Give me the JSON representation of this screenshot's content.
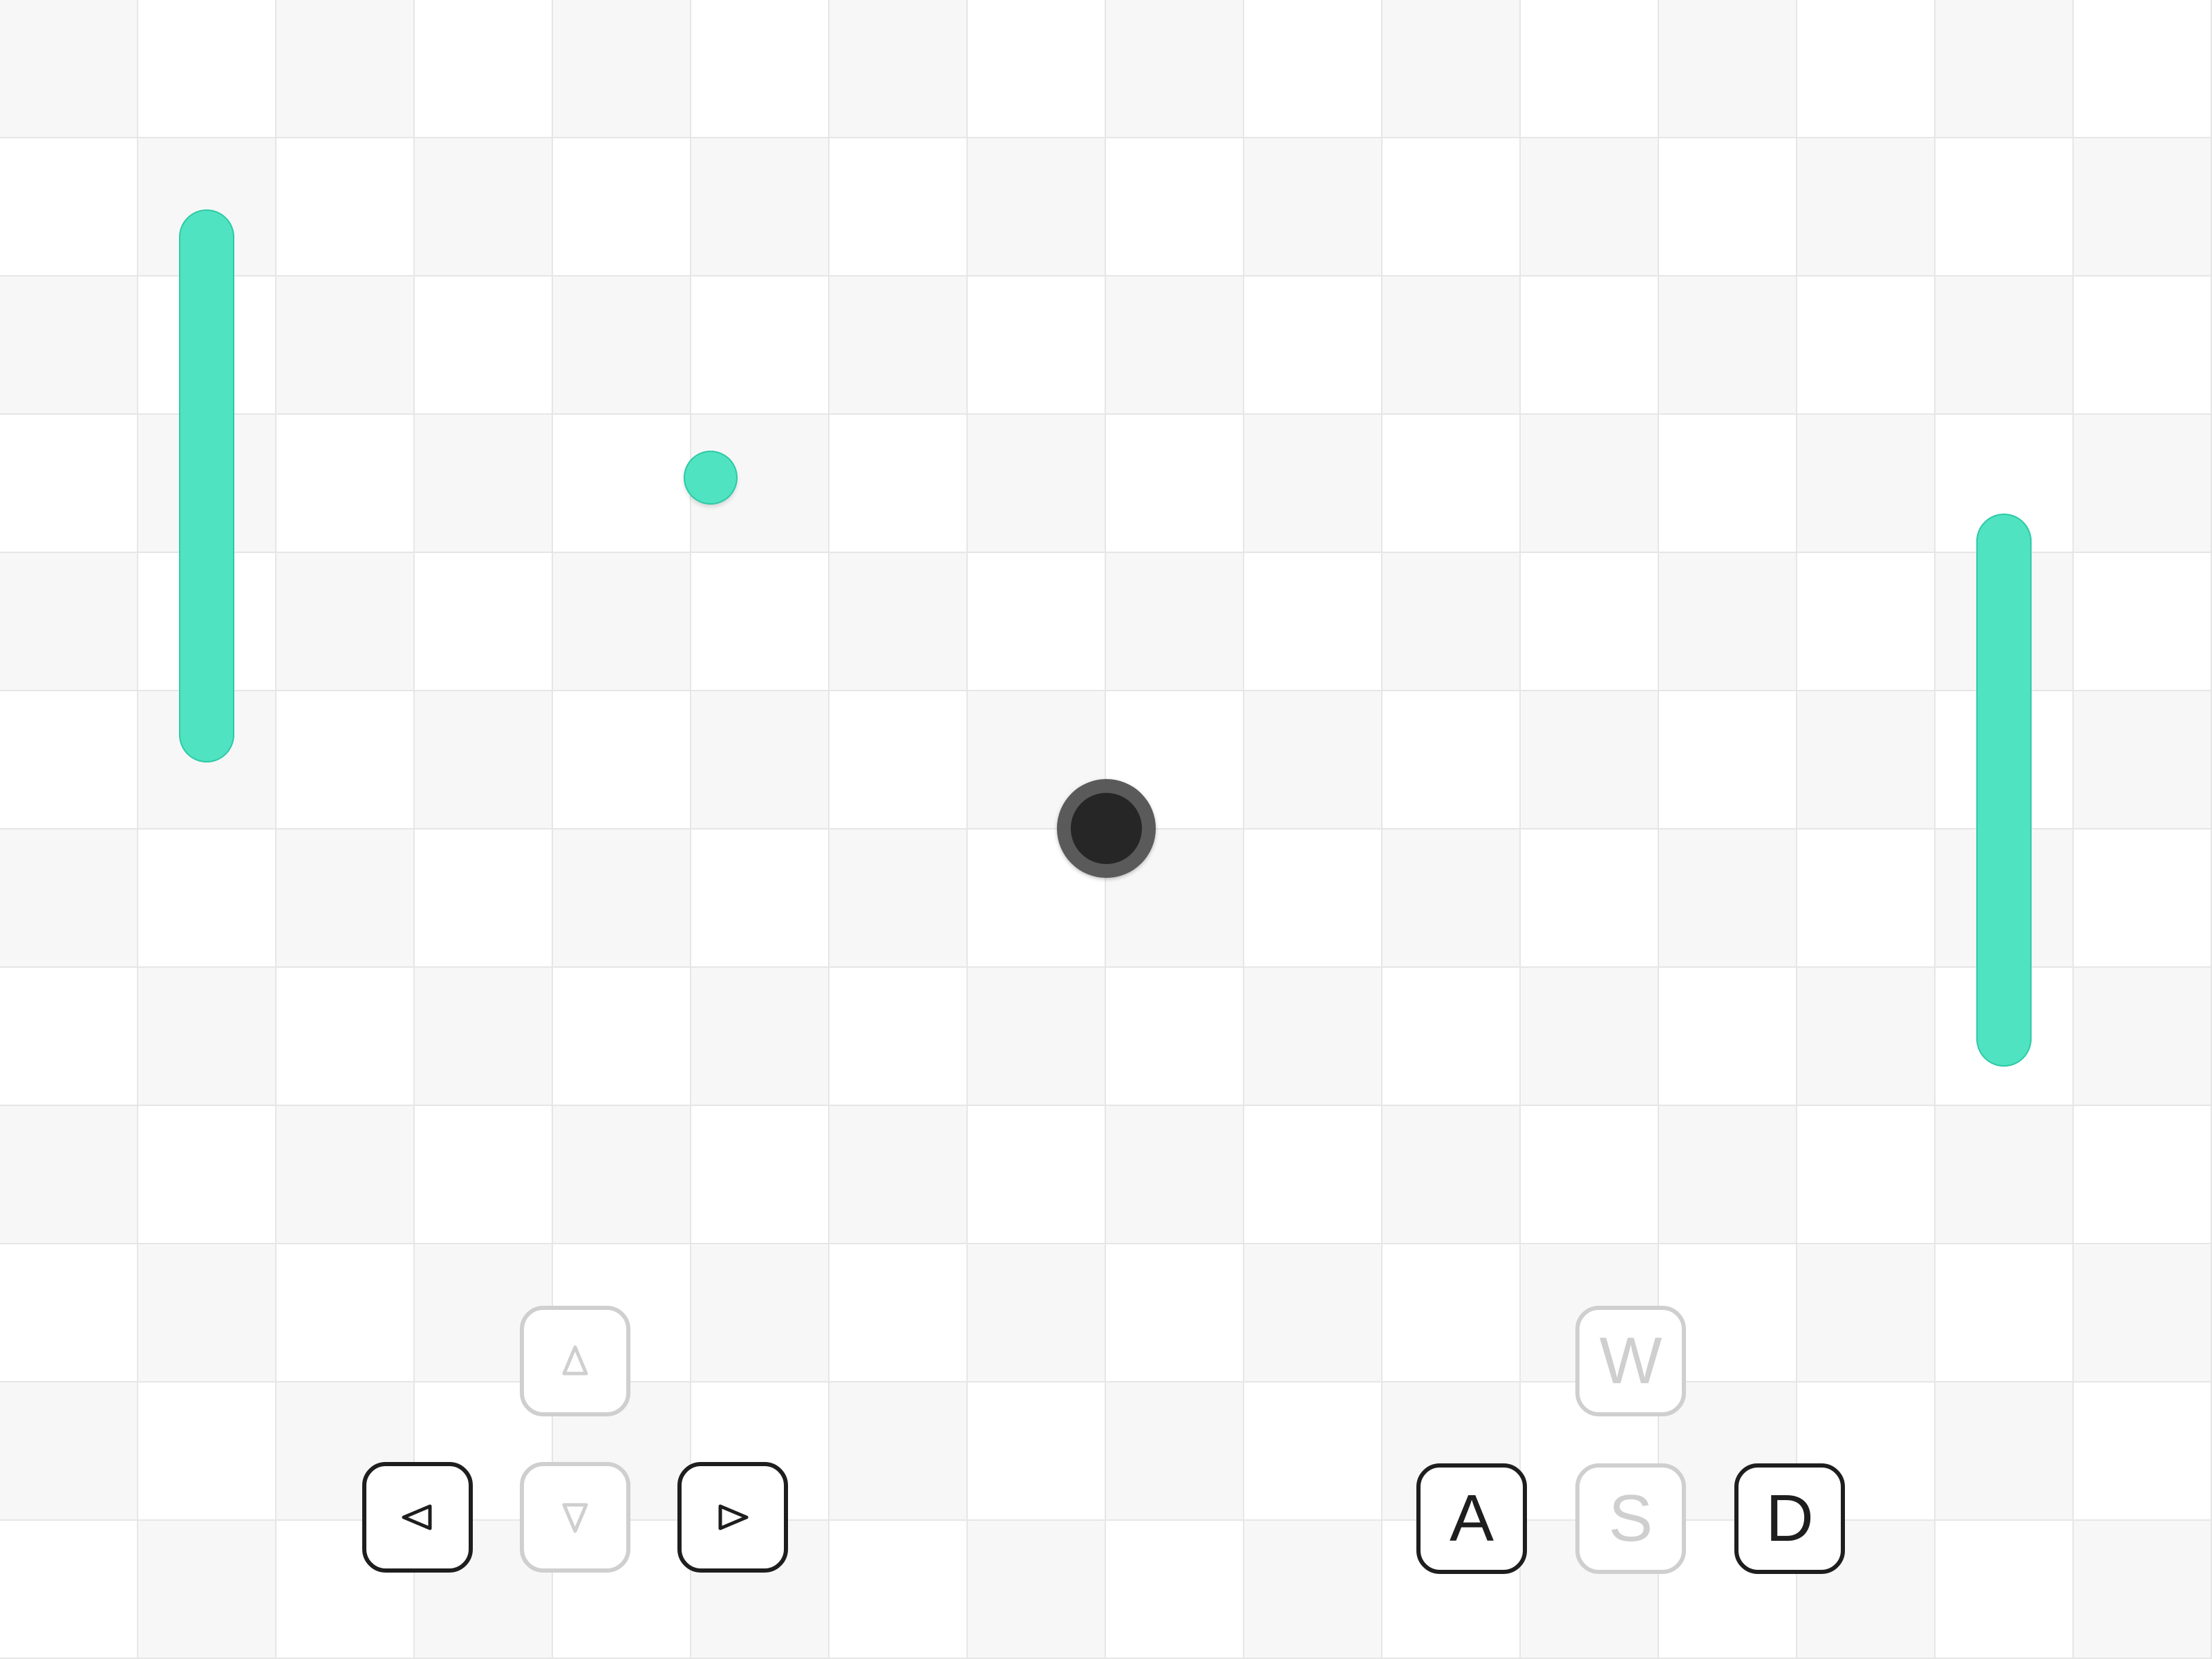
{
  "colors": {
    "background": "#ffffff",
    "grid_shade": "#f7f7f7",
    "grid_line": "#e6e6e6",
    "paddle": "#50e3c2",
    "ball": "#50e3c2",
    "hole_ring": "#5a5a5a",
    "hole_center": "#262626",
    "key_active": "#1e1e1e",
    "key_inactive": "#cfcfcf"
  },
  "board": {
    "columns": 16,
    "rows": 12
  },
  "controls": {
    "arrow_keys": [
      {
        "id": "up",
        "icon": "arrow-up-icon",
        "active": false
      },
      {
        "id": "left",
        "icon": "arrow-left-icon",
        "active": true
      },
      {
        "id": "down",
        "icon": "arrow-down-icon",
        "active": false
      },
      {
        "id": "right",
        "icon": "arrow-right-icon",
        "active": true
      }
    ],
    "letter_keys": [
      {
        "id": "w",
        "label": "W",
        "active": false
      },
      {
        "id": "a",
        "label": "A",
        "active": true
      },
      {
        "id": "s",
        "label": "S",
        "active": false
      },
      {
        "id": "d",
        "label": "D",
        "active": true
      }
    ]
  }
}
